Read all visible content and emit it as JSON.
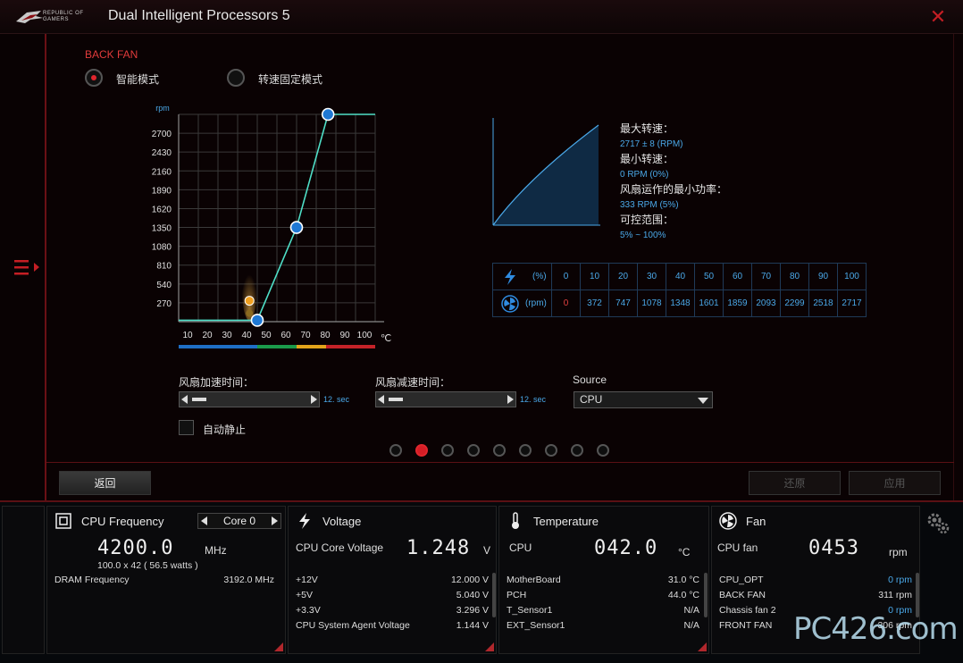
{
  "window": {
    "title": "Dual Intelligent Processors 5",
    "brand": "REPUBLIC OF GAMERS"
  },
  "fan": {
    "name": "BACK FAN",
    "modes": [
      {
        "label": "智能模式",
        "selected": true
      },
      {
        "label": "转速固定模式",
        "selected": false
      }
    ]
  },
  "chart_data": {
    "type": "line",
    "ylabel": "rpm",
    "xlabel": "℃",
    "y_ticks": [
      "2700",
      "2430",
      "2160",
      "1890",
      "1620",
      "1350",
      "1080",
      "810",
      "540",
      "270"
    ],
    "x_ticks": [
      "10",
      "20",
      "30",
      "40",
      "50",
      "60",
      "70",
      "80",
      "90",
      "100"
    ],
    "xlim": [
      0,
      100
    ],
    "ylim": [
      0,
      2970
    ],
    "grid": true,
    "points": [
      {
        "x": 40,
        "y": 20
      },
      {
        "x": 60,
        "y": 1350
      },
      {
        "x": 76,
        "y": 2970
      }
    ],
    "current_temp_marker": {
      "x": 36,
      "y": 300
    },
    "zone_colors": [
      "#1f6fc6",
      "#1b9a4a",
      "#e3a51b",
      "#c42228"
    ]
  },
  "stats": {
    "max_label": "最大转速：",
    "max_value": "2717 ± 8 (RPM)",
    "min_label": "最小转速：",
    "min_value": "0 RPM (0%)",
    "minpower_label": "风扇运作的最小功率：",
    "minpower_value": "333 RPM (5%)",
    "range_label": "可控范围：",
    "range_value": "5% ~ 100%"
  },
  "speed_table": {
    "pct_unit": "(%)",
    "rpm_unit": "(rpm)",
    "percents": [
      "0",
      "10",
      "20",
      "30",
      "40",
      "50",
      "60",
      "70",
      "80",
      "90",
      "100"
    ],
    "rpms": [
      "0",
      "372",
      "747",
      "1078",
      "1348",
      "1601",
      "1859",
      "2093",
      "2299",
      "2518",
      "2717"
    ]
  },
  "controls": {
    "accel_label": "风扇加速时间：",
    "accel_value": "12. sec",
    "decel_label": "风扇减速时间：",
    "decel_value": "12. sec",
    "source_label": "Source",
    "source_value": "CPU",
    "autostop_label": "自动静止"
  },
  "pager": {
    "count": 9,
    "active": 1
  },
  "buttons": {
    "back": "返回",
    "restore": "还原",
    "apply": "应用"
  },
  "cpu": {
    "title": "CPU Frequency",
    "core": "Core 0",
    "freq": "4200.0",
    "freq_unit": "MHz",
    "detail": "100.0  x 42  ( 56.5    watts )",
    "dram_label": "DRAM Frequency",
    "dram_value": "3192.0  MHz"
  },
  "voltage": {
    "title": "Voltage",
    "core_label": "CPU Core Voltage",
    "core_value": "1.248",
    "core_unit": "V",
    "rows": [
      {
        "label": "+12V",
        "value": "12.000  V"
      },
      {
        "label": "+5V",
        "value": "5.040  V"
      },
      {
        "label": "+3.3V",
        "value": "3.296  V"
      },
      {
        "label": "CPU System Agent Voltage",
        "value": "1.144  V"
      }
    ]
  },
  "temperature": {
    "title": "Temperature",
    "cpu_label": "CPU",
    "cpu_value": "042.0",
    "cpu_unit": "°C",
    "rows": [
      {
        "label": "MotherBoard",
        "value": "31.0 °C"
      },
      {
        "label": "PCH",
        "value": "44.0 °C"
      },
      {
        "label": "T_Sensor1",
        "value": "N/A"
      },
      {
        "label": "EXT_Sensor1",
        "value": "N/A"
      }
    ]
  },
  "fans": {
    "title": "Fan",
    "cpu_label": "CPU fan",
    "cpu_value": "0453",
    "cpu_unit": "rpm",
    "rows": [
      {
        "label": "CPU_OPT",
        "value": "0  rpm",
        "blue": true
      },
      {
        "label": "BACK FAN",
        "value": "311  rpm",
        "blue": false
      },
      {
        "label": "Chassis fan 2",
        "value": "0  rpm",
        "blue": true
      },
      {
        "label": "FRONT FAN",
        "value": "306  rpm",
        "blue": false
      }
    ]
  },
  "watermark": "PC426.com"
}
